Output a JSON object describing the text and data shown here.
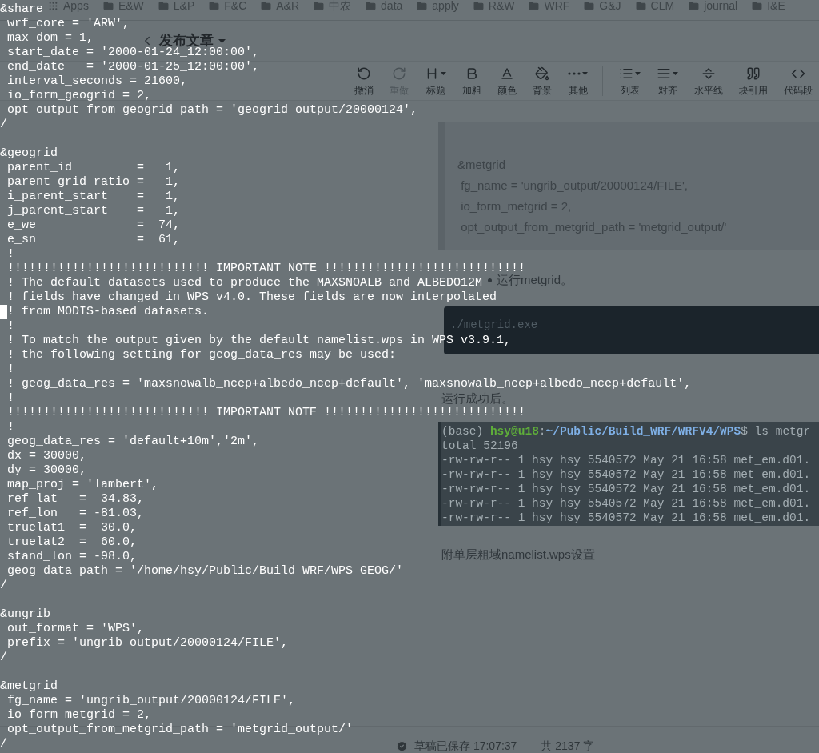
{
  "bookmarks": [
    {
      "label": "Apps",
      "kind": "apps"
    },
    {
      "label": "E&W",
      "kind": "folder"
    },
    {
      "label": "L&P",
      "kind": "folder"
    },
    {
      "label": "F&C",
      "kind": "folder"
    },
    {
      "label": "A&R",
      "kind": "folder"
    },
    {
      "label": "中农",
      "kind": "folder"
    },
    {
      "label": "data",
      "kind": "folder"
    },
    {
      "label": "apply",
      "kind": "folder"
    },
    {
      "label": "R&W",
      "kind": "folder"
    },
    {
      "label": "WRF",
      "kind": "folder"
    },
    {
      "label": "G&J",
      "kind": "folder"
    },
    {
      "label": "CLM",
      "kind": "folder"
    },
    {
      "label": "journal",
      "kind": "folder"
    },
    {
      "label": "I&E",
      "kind": "folder"
    }
  ],
  "header": {
    "title": "发布文章"
  },
  "toolbar": [
    [
      {
        "label": "撤消",
        "kind": "undo",
        "disabled": false,
        "dropdown": false
      },
      {
        "label": "重做",
        "kind": "redo",
        "disabled": true,
        "dropdown": false
      },
      {
        "label": "标题",
        "kind": "heading",
        "disabled": false,
        "dropdown": true
      },
      {
        "label": "加粗",
        "kind": "bold",
        "disabled": false,
        "dropdown": false
      },
      {
        "label": "颜色",
        "kind": "color",
        "disabled": false,
        "dropdown": false
      },
      {
        "label": "背景",
        "kind": "background",
        "disabled": false,
        "dropdown": false
      },
      {
        "label": "其他",
        "kind": "more",
        "disabled": false,
        "dropdown": true
      }
    ],
    [
      {
        "label": "列表",
        "kind": "list",
        "disabled": false,
        "dropdown": true
      },
      {
        "label": "对齐",
        "kind": "align",
        "disabled": false,
        "dropdown": true
      },
      {
        "label": "水平线",
        "kind": "rule",
        "disabled": false,
        "dropdown": false
      },
      {
        "label": "块引用",
        "kind": "quote",
        "disabled": false,
        "dropdown": false
      },
      {
        "label": "代码段",
        "kind": "code",
        "disabled": false,
        "dropdown": false
      }
    ]
  ],
  "content": [
    {
      "kind": "quote",
      "lines": [
        "&metgrid",
        " fg_name = 'ungrib_output/20000124/FILE',",
        " io_form_metgrid = 2,",
        " opt_output_from_metgrid_path = 'metgrid_output/'"
      ]
    },
    {
      "kind": "bullet",
      "text": "运行metgrid。"
    },
    {
      "kind": "code",
      "text": "./metgrid.exe"
    },
    {
      "kind": "paragraph",
      "text": "运行成功后。"
    },
    {
      "kind": "screenshot",
      "lines": [
        [
          {
            "text": "(base) ",
            "kind": "plain"
          },
          {
            "text": "hsy@u18",
            "kind": "user"
          },
          {
            "text": ":",
            "kind": "plain"
          },
          {
            "text": "~/Public/Build_WRF/WRFV4/WPS",
            "kind": "path"
          },
          {
            "text": "$ ls metgr",
            "kind": "plain"
          }
        ],
        [
          {
            "text": "total 52196",
            "kind": "plain"
          }
        ],
        [
          {
            "text": "-rw-rw-r-- 1 hsy hsy 5540572 May 21 16:58 met_em.d01.",
            "kind": "plain"
          }
        ],
        [
          {
            "text": "-rw-rw-r-- 1 hsy hsy 5540572 May 21 16:58 met_em.d01.",
            "kind": "plain"
          }
        ],
        [
          {
            "text": "-rw-rw-r-- 1 hsy hsy 5540572 May 21 16:58 met_em.d01.",
            "kind": "plain"
          }
        ],
        [
          {
            "text": "-rw-rw-r-- 1 hsy hsy 5540572 May 21 16:58 met_em.d01.",
            "kind": "plain"
          }
        ],
        [
          {
            "text": "-rw-rw-r-- 1 hsy hsy 5540572 May 21 16:58 met_em.d01.",
            "kind": "plain"
          }
        ]
      ]
    },
    {
      "kind": "paragraph",
      "text": "附单层粗域namelist.wps设置"
    }
  ],
  "footer": {
    "status": "草稿已保存 17:07:37",
    "count": "共 2137 字"
  },
  "terminal": {
    "blocks": [
      [
        {
          "text": "&share",
          "cursor": false
        },
        {
          "text": " wrf_core = 'ARW',",
          "cursor": false
        },
        {
          "text": " max_dom = 1,",
          "cursor": false
        },
        {
          "text": " start_date = '2000-01-24_12:00:00',",
          "cursor": false
        },
        {
          "text": " end_date   = '2000-01-25_12:00:00',",
          "cursor": false
        },
        {
          "text": " interval_seconds = 21600,",
          "cursor": false
        },
        {
          "text": " io_form_geogrid = 2,",
          "cursor": false
        },
        {
          "text": " opt_output_from_geogrid_path = 'geogrid_output/20000124',",
          "cursor": false
        },
        {
          "text": "/",
          "cursor": false
        }
      ],
      [
        {
          "text": "&geogrid",
          "cursor": false
        },
        {
          "text": " parent_id         =   1,",
          "cursor": false
        },
        {
          "text": " parent_grid_ratio =   1,",
          "cursor": false
        },
        {
          "text": " i_parent_start    =   1,",
          "cursor": false
        },
        {
          "text": " j_parent_start    =   1,",
          "cursor": false
        },
        {
          "text": " e_we              =  74,",
          "cursor": false
        },
        {
          "text": " e_sn              =  61,",
          "cursor": false
        },
        {
          "text": " !",
          "cursor": false
        },
        {
          "text": " !!!!!!!!!!!!!!!!!!!!!!!!!!!! IMPORTANT NOTE !!!!!!!!!!!!!!!!!!!!!!!!!!!!",
          "cursor": false
        },
        {
          "text": " ! The default datasets used to produce the MAXSNOALB and ALBEDO12M",
          "cursor": false
        },
        {
          "text": " ! fields have changed in WPS v4.0. These fields are now interpolated",
          "cursor": false
        },
        {
          "text": "! from MODIS-based datasets.",
          "cursor": true
        },
        {
          "text": " !",
          "cursor": false
        },
        {
          "text": " ! To match the output given by the default namelist.wps in WPS v3.9.1,",
          "cursor": false
        },
        {
          "text": " ! the following setting for geog_data_res may be used:",
          "cursor": false
        },
        {
          "text": " !",
          "cursor": false
        },
        {
          "text": " ! geog_data_res = 'maxsnowalb_ncep+albedo_ncep+default', 'maxsnowalb_ncep+albedo_ncep+default',",
          "cursor": false
        },
        {
          "text": " !",
          "cursor": false
        },
        {
          "text": " !!!!!!!!!!!!!!!!!!!!!!!!!!!! IMPORTANT NOTE !!!!!!!!!!!!!!!!!!!!!!!!!!!!",
          "cursor": false
        },
        {
          "text": " !",
          "cursor": false
        },
        {
          "text": " geog_data_res = 'default+10m','2m',",
          "cursor": false
        },
        {
          "text": " dx = 30000,",
          "cursor": false
        },
        {
          "text": " dy = 30000,",
          "cursor": false
        },
        {
          "text": " map_proj = 'lambert',",
          "cursor": false
        },
        {
          "text": " ref_lat   =  34.83,",
          "cursor": false
        },
        {
          "text": " ref_lon   = -81.03,",
          "cursor": false
        },
        {
          "text": " truelat1  =  30.0,",
          "cursor": false
        },
        {
          "text": " truelat2  =  60.0,",
          "cursor": false
        },
        {
          "text": " stand_lon = -98.0,",
          "cursor": false
        },
        {
          "text": " geog_data_path = '/home/hsy/Public/Build_WRF/WPS_GEOG/'",
          "cursor": false
        },
        {
          "text": "/",
          "cursor": false
        }
      ],
      [
        {
          "text": "&ungrib",
          "cursor": false
        },
        {
          "text": " out_format = 'WPS',",
          "cursor": false
        },
        {
          "text": " prefix = 'ungrib_output/20000124/FILE',",
          "cursor": false
        },
        {
          "text": "/",
          "cursor": false
        }
      ],
      [
        {
          "text": "&metgrid",
          "cursor": false
        },
        {
          "text": " fg_name = 'ungrib_output/20000124/FILE',",
          "cursor": false
        },
        {
          "text": " io_form_metgrid = 2,",
          "cursor": false
        },
        {
          "text": " opt_output_from_metgrid_path = 'metgrid_output/'",
          "cursor": false
        },
        {
          "text": "/",
          "cursor": false
        }
      ]
    ]
  }
}
